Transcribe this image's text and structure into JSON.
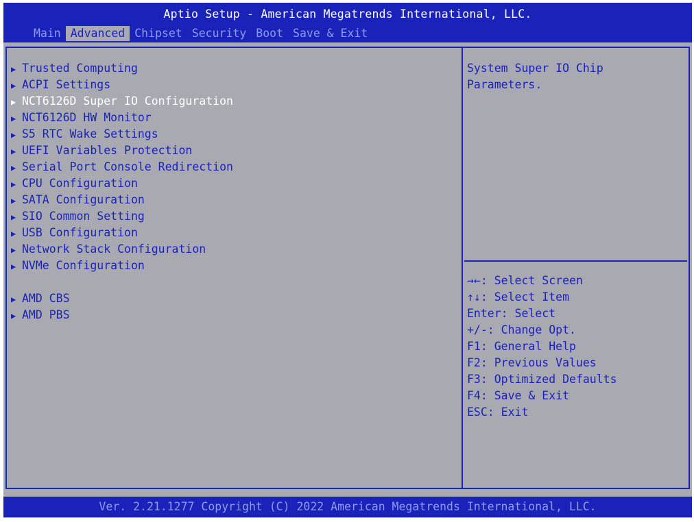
{
  "header": {
    "title": "Aptio Setup - American Megatrends International, LLC.",
    "tabs": [
      {
        "label": "Main"
      },
      {
        "label": "Advanced"
      },
      {
        "label": "Chipset"
      },
      {
        "label": "Security"
      },
      {
        "label": "Boot"
      },
      {
        "label": "Save & Exit"
      }
    ],
    "active_tab": "Advanced"
  },
  "menu": {
    "arrow_icon": "▶",
    "items": [
      {
        "label": "Trusted Computing"
      },
      {
        "label": "ACPI Settings"
      },
      {
        "label": "NCT6126D Super IO Configuration"
      },
      {
        "label": "NCT6126D HW Monitor"
      },
      {
        "label": "S5 RTC Wake Settings"
      },
      {
        "label": "UEFI Variables Protection"
      },
      {
        "label": "Serial Port Console Redirection"
      },
      {
        "label": "CPU Configuration"
      },
      {
        "label": "SATA Configuration"
      },
      {
        "label": "SIO Common Setting"
      },
      {
        "label": "USB Configuration"
      },
      {
        "label": "Network Stack Configuration"
      },
      {
        "label": "NVMe Configuration"
      },
      {
        "label": "AMD CBS"
      },
      {
        "label": "AMD PBS"
      }
    ],
    "selected_label": "NCT6126D Super IO Configuration"
  },
  "help": {
    "line1": "System Super IO Chip",
    "line2": "Parameters."
  },
  "keys": [
    "→←: Select Screen",
    "↑↓: Select Item",
    "Enter: Select",
    "+/-: Change Opt.",
    "F1: General Help",
    "F2: Previous Values",
    "F3: Optimized Defaults",
    "F4: Save & Exit",
    "ESC: Exit"
  ],
  "footer": {
    "text": "Ver. 2.21.1277 Copyright (C) 2022 American Megatrends International, LLC."
  },
  "colors": {
    "bios_blue": "#1a23b9",
    "panel_gray": "#a9a9b1",
    "inactive_tab": "#8f9af0",
    "selected_text": "#ffffff"
  }
}
